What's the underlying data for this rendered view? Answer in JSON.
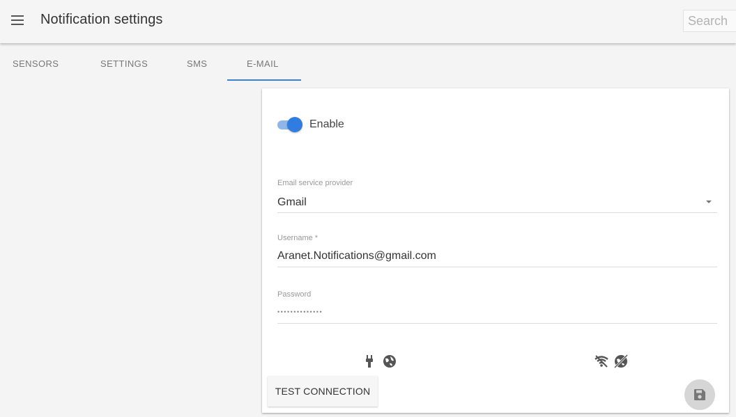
{
  "header": {
    "title": "Notification settings",
    "search_placeholder": "Search"
  },
  "tabs": [
    {
      "label": "SENSORS",
      "active": false
    },
    {
      "label": "SETTINGS",
      "active": false
    },
    {
      "label": "SMS",
      "active": false
    },
    {
      "label": "E-MAIL",
      "active": true
    }
  ],
  "colors": {
    "accent": "#2f7de1",
    "tab_ink": "#3b82d6",
    "header_bg": "#f5f5f5",
    "page_bg": "#f4f4f4"
  },
  "email_form": {
    "enable": {
      "label": "Enable",
      "checked": true
    },
    "provider": {
      "label": "Email service provider",
      "value": "Gmail"
    },
    "username": {
      "label": "Username *",
      "value": "Aranet.Notifications@gmail.com"
    },
    "password": {
      "label": "Password",
      "value": "••••••••••••••"
    },
    "status_icons": [
      "plug-icon",
      "globe-icon",
      "wifi-off-icon",
      "globe-off-icon"
    ],
    "test_button_label": "TEST CONNECTION",
    "save_icon": "save-icon"
  }
}
